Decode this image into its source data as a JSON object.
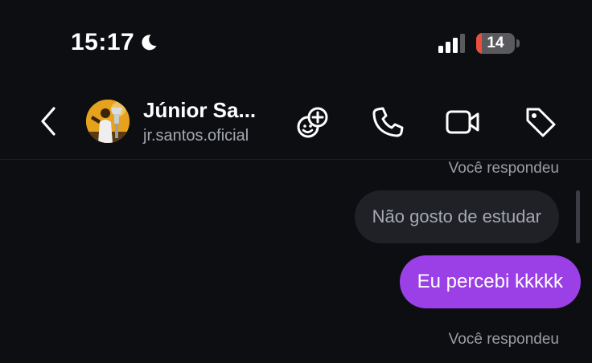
{
  "status_bar": {
    "time": "15:17",
    "battery_level": "14",
    "battery_fraction": 0.14,
    "focus_icon": "moon-icon",
    "signal_icon": "cellular-signal-icon"
  },
  "header": {
    "contact_name": "Júnior Sa...",
    "contact_username": "jr.santos.oficial",
    "back_icon": "chevron-left-icon",
    "actions": [
      "effects-icon",
      "phone-icon",
      "video-camera-icon",
      "tag-icon"
    ]
  },
  "messages": {
    "reply_label_1": "Você respondeu",
    "quoted_text": "Não gosto de estudar",
    "sent_text": "Eu percebi kkkkk",
    "reply_label_2": "Você respondeu"
  },
  "colors": {
    "background": "#0c0e12",
    "sent_bubble": "#9b3fe6",
    "quoted_bubble": "#1f2127",
    "battery_low": "#eb4e3d"
  }
}
